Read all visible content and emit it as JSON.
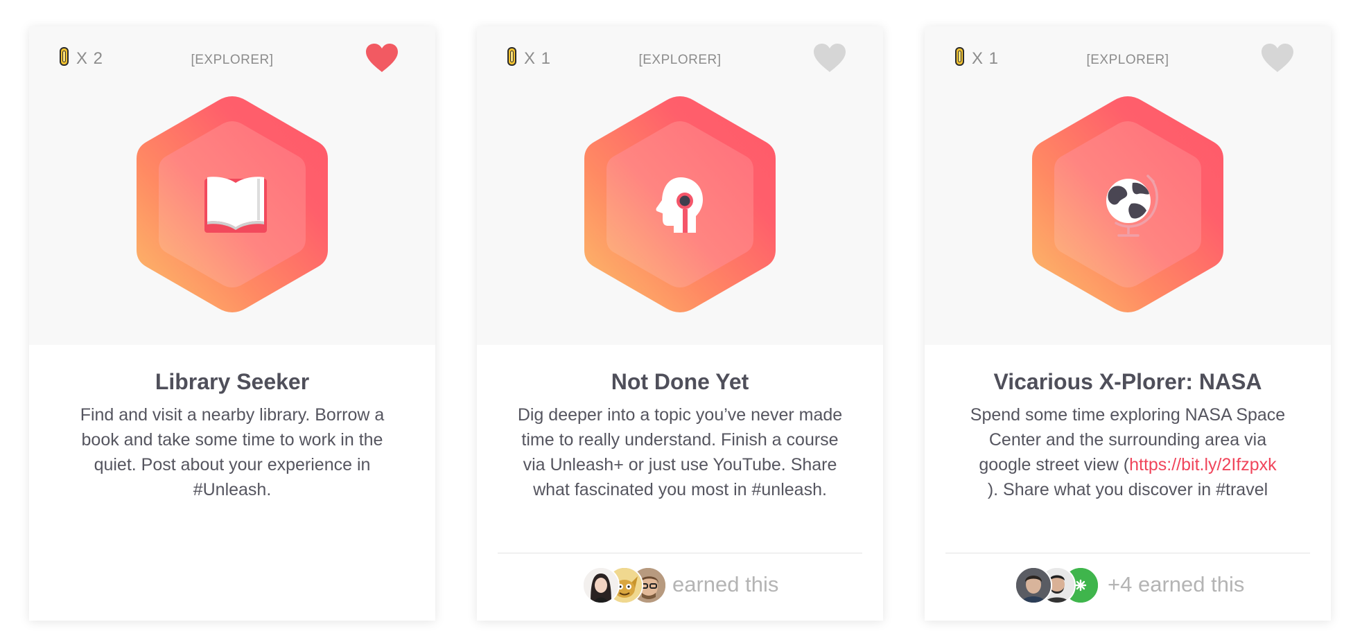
{
  "cards": [
    {
      "multiplier": "X 2",
      "category": "[EXPLORER]",
      "favorited": true,
      "badge_icon": "book-icon",
      "title": "Library Seeker",
      "description": "Find and visit a nearby library. Borrow a book and take some time to work in the quiet. Post about your experience in #Unleash."
    },
    {
      "multiplier": "X 1",
      "category": "[EXPLORER]",
      "favorited": false,
      "badge_icon": "head-idea-icon",
      "title": "Not Done Yet",
      "description": "Dig deeper into a topic you’ve never made time to really understand. Finish a course via Unleash+ or just use YouTube. Share what fascinated you most in #unleash.",
      "earned_text": "earned this"
    },
    {
      "multiplier": "X 1",
      "category": "[EXPLORER]",
      "favorited": false,
      "badge_icon": "globe-icon",
      "title": "Vicarious X-Plorer: NASA",
      "description_before": "Spend some time exploring NASA Space Center and the surrounding area via google street view (",
      "description_link": "https://bit.ly/2Ifzpxk",
      "description_after": "). Share what you discover in #travel",
      "earned_text": "+4 earned this"
    }
  ],
  "colors": {
    "heart_active": "#f25a62",
    "heart_inactive": "#d6d6d6",
    "badge_outer_top": "#ff5a6a",
    "badge_outer_bottom": "#fbb66a",
    "link": "#f0455b"
  }
}
